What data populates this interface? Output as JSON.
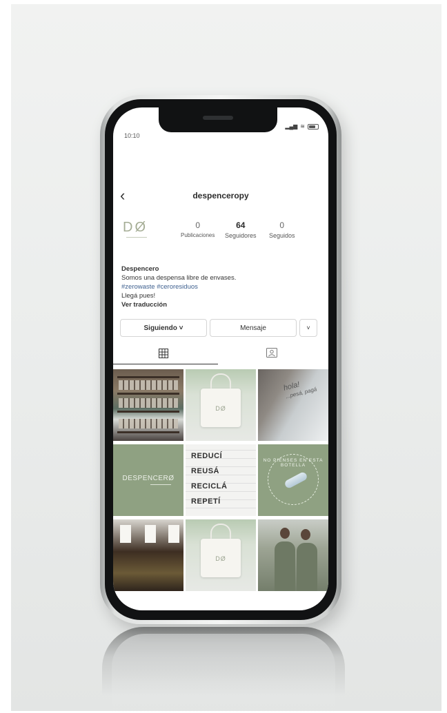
{
  "status_bar": {
    "time": "10:10",
    "signal": "▂▄▆",
    "wifi": "≋"
  },
  "profile": {
    "back_glyph": "‹",
    "username": "despenceropy",
    "avatar_text": "DØ",
    "stats": [
      {
        "value": "0",
        "label": "Publicaciones"
      },
      {
        "value": "64",
        "label": "Seguidores"
      },
      {
        "value": "0",
        "label": "Seguidos"
      }
    ],
    "bio": {
      "name": "Despencero",
      "line1": "Somos una despensa libre de envases.",
      "tags": "#zerowaste #ceroresiduos",
      "line2": "Llegá pues!",
      "translate": "Ver traducción"
    }
  },
  "actions": {
    "follow": "Siguiendo ˅",
    "message": "Mensaje",
    "more": "˅"
  },
  "grid": {
    "bag_logo": "DØ",
    "hola": "hola!",
    "hola_sub": "...pesá, pagá",
    "brand_word": "DESPENCERØ",
    "slogan": [
      "REDUCÍ",
      "REUSÁ",
      "RECICLÁ",
      "REPETÍ"
    ],
    "ring_text": "NO PIENSES EN ESTA BOTELLA"
  },
  "colors": {
    "sage": "#8fa182",
    "link": "#3d5f8e"
  }
}
